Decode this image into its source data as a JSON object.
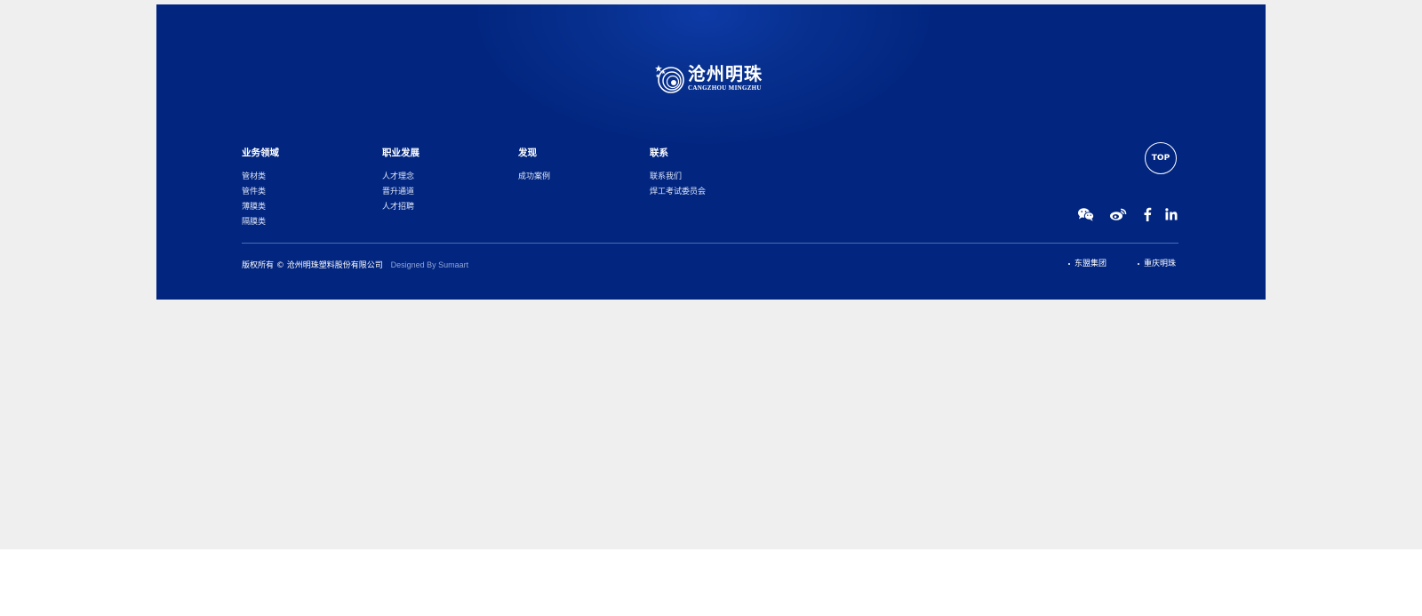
{
  "logo": {
    "cn": "沧州明珠",
    "en": "CANGZHOU MINGZHU"
  },
  "columns": [
    {
      "title": "业务领域",
      "links": [
        "管材类",
        "管件类",
        "薄膜类",
        "隔膜类"
      ]
    },
    {
      "title": "职业发展",
      "links": [
        "人才理念",
        "晋升通道",
        "人才招聘"
      ]
    },
    {
      "title": "发现",
      "links": [
        "成功案例"
      ]
    },
    {
      "title": "联系",
      "links": [
        "联系我们",
        "焊工考试委员会"
      ]
    }
  ],
  "top_button": {
    "label": "TOP"
  },
  "social": [
    "wechat-icon",
    "weibo-icon",
    "facebook-icon",
    "linkedin-icon"
  ],
  "copyright": {
    "text": "版权所有 © 沧州明珠塑料股份有限公司",
    "designer": "Designed By Sumaart"
  },
  "group_links": [
    "东盟集团",
    "重庆明珠"
  ],
  "colors": {
    "footer_bg": "#022680",
    "page_bg": "#efefef",
    "divider": "#4c6bb4",
    "designer_text": "#8fa3d6"
  }
}
